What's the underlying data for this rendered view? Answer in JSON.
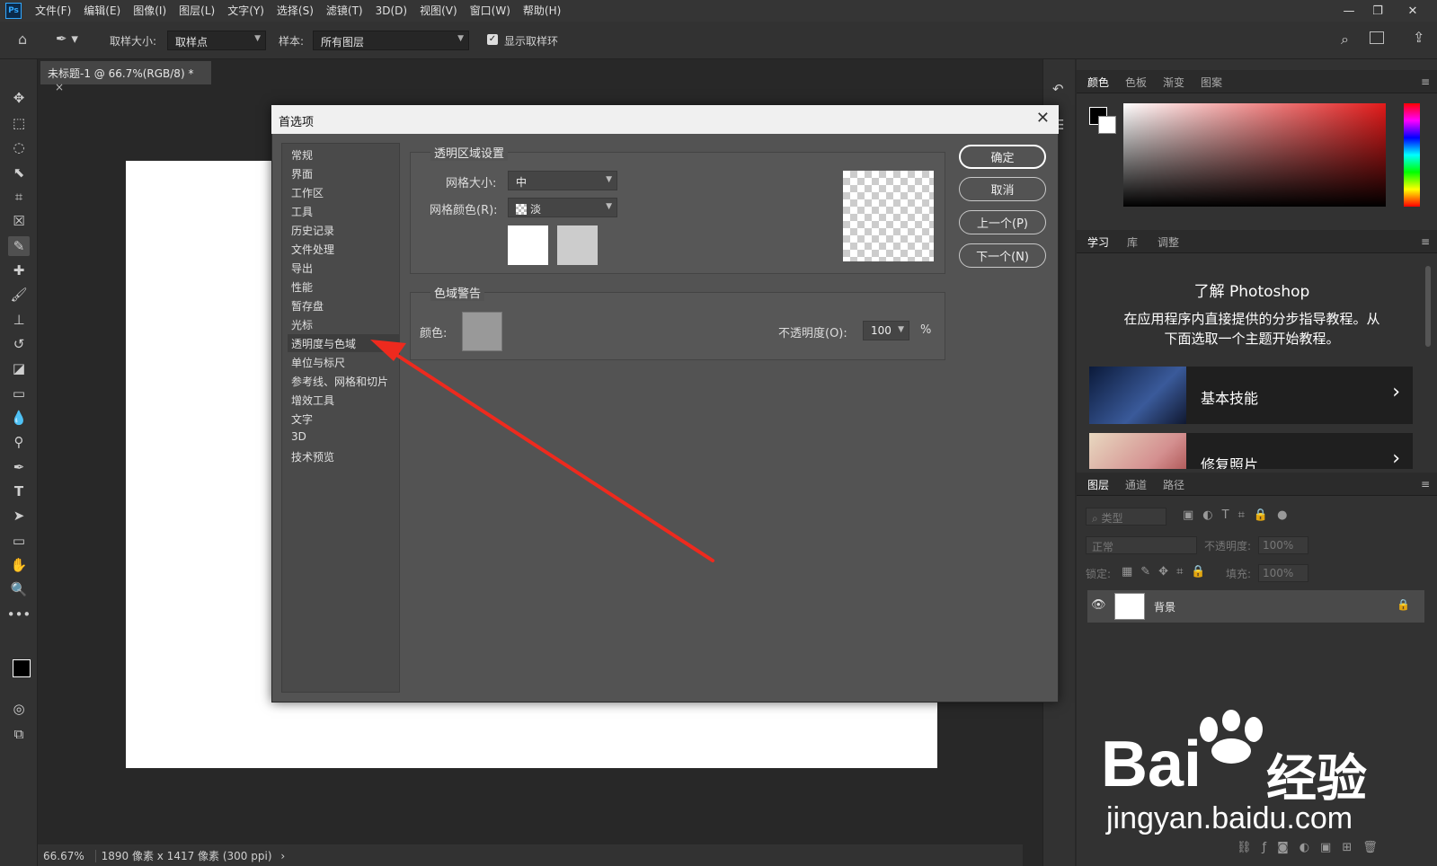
{
  "app": {
    "logo": "Ps"
  },
  "menubar": {
    "items": [
      "文件(F)",
      "编辑(E)",
      "图像(I)",
      "图层(L)",
      "文字(Y)",
      "选择(S)",
      "滤镜(T)",
      "3D(D)",
      "视图(V)",
      "窗口(W)",
      "帮助(H)"
    ]
  },
  "options": {
    "sample_size_label": "取样大小:",
    "sample_size_value": "取样点",
    "sample_label": "样本:",
    "sample_value": "所有图层",
    "show_ring_label": "显示取样环"
  },
  "document": {
    "tab_title": "未标题-1 @ 66.7%(RGB/8) *",
    "close_glyph": "×"
  },
  "status": {
    "zoom": "66.67%",
    "info": "1890 像素 x 1417 像素 (300 ppi)",
    "arrow": "›"
  },
  "panels": {
    "color_tabs": [
      "颜色",
      "色板",
      "渐变",
      "图案"
    ],
    "learn_tabs": [
      "学习",
      "库",
      "调整"
    ],
    "learn_heading": "了解 Photoshop",
    "learn_desc_1": "在应用程序内直接提供的分步指导教程。从",
    "learn_desc_2": "下面选取一个主题开始教程。",
    "learn_cards": [
      "基本技能",
      "修复照片"
    ],
    "layers_tabs": [
      "图层",
      "通道",
      "路径"
    ],
    "layers_filter_placeholder": "类型",
    "blend_mode": "正常",
    "opacity_label": "不透明度:",
    "opacity_value": "100%",
    "lock_label": "锁定:",
    "fill_label": "填充:",
    "fill_value": "100%",
    "layer_name": "背景"
  },
  "dialog": {
    "title": "首选项",
    "nav": [
      "常规",
      "界面",
      "工作区",
      "工具",
      "历史记录",
      "文件处理",
      "导出",
      "性能",
      "暂存盘",
      "光标",
      "透明度与色域",
      "单位与标尺",
      "参考线、网格和切片",
      "增效工具",
      "文字",
      "3D",
      "技术预览"
    ],
    "selected_nav": "透明度与色域",
    "transparency_group": "透明区域设置",
    "grid_size_label": "网格大小:",
    "grid_size_value": "中",
    "grid_color_label": "网格颜色(R):",
    "grid_color_value": "淡",
    "gamut_group": "色域警告",
    "gamut_color_label": "颜色:",
    "gamut_opacity_label": "不透明度(O):",
    "gamut_opacity_value": "100",
    "gamut_opacity_unit": "%",
    "buttons": {
      "ok": "确定",
      "cancel": "取消",
      "prev": "上一个(P)",
      "next": "下一个(N)"
    }
  },
  "watermark": {
    "brand_text": "Bai",
    "brand_text2": "经验",
    "url": "jingyan.baidu.com"
  }
}
